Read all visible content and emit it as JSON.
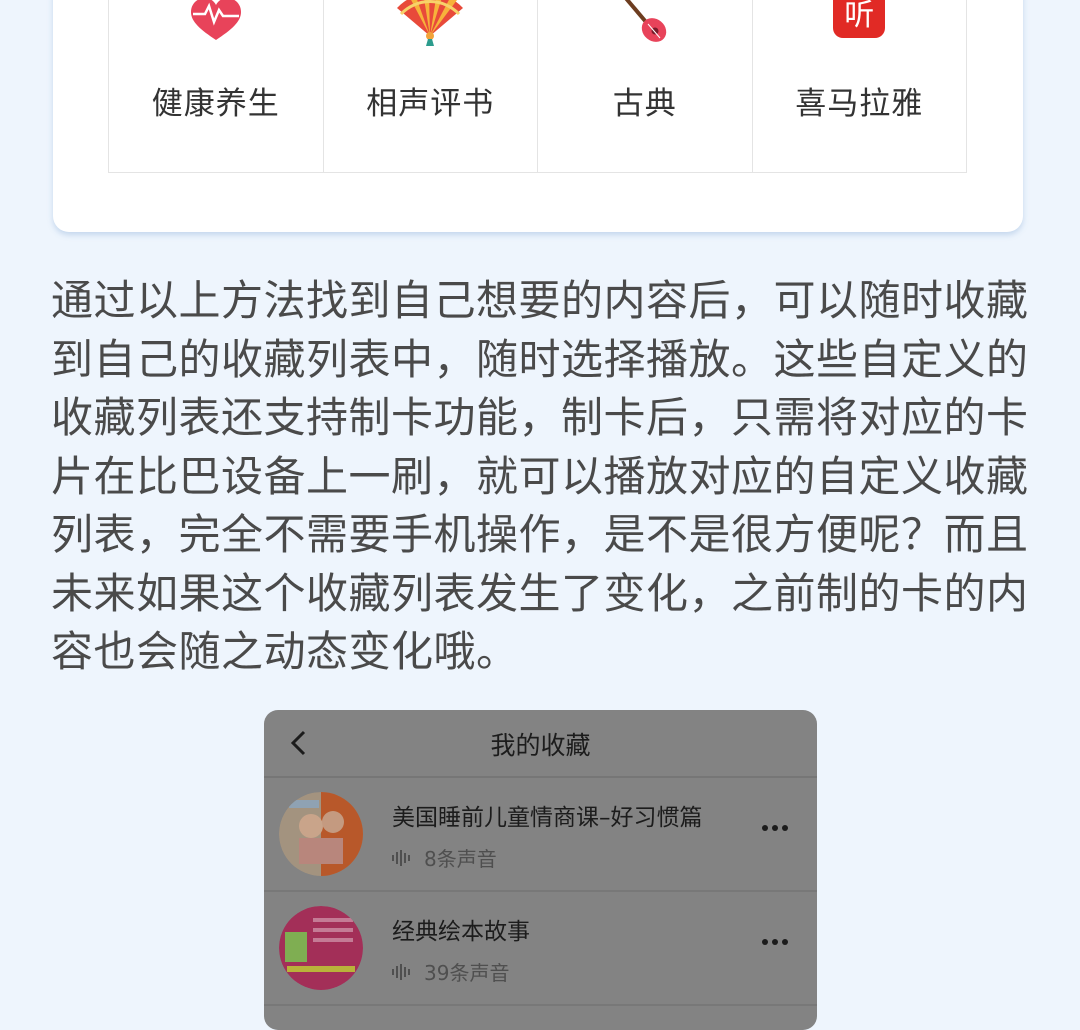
{
  "categories": [
    {
      "label": "健康养生",
      "icon": "heart-pulse-icon"
    },
    {
      "label": "相声评书",
      "icon": "folding-fan-icon"
    },
    {
      "label": "古典",
      "icon": "guitar-icon"
    },
    {
      "label": "喜马拉雅",
      "icon": "ximalaya-ting-icon"
    }
  ],
  "logo_text": "听",
  "paragraph": "通过以上方法找到自己想要的内容后，可以随时收藏到自己的收藏列表中，随时选择播放。这些自定义的收藏列表还支持制卡功能，制卡后，只需将对应的卡片在比巴设备上一刷，就可以播放对应的自定义收藏列表，完全不需要手机操作，是不是很方便呢？而且未来如果这个收藏列表发生了变化，之前制的卡的内容也会随之动态变化哦。",
  "favorites": {
    "title": "我的收藏",
    "items": [
      {
        "title": "美国睡前儿童情商课–好习惯篇",
        "count": "8条声音"
      },
      {
        "title": "经典绘本故事",
        "count": "39条声音"
      }
    ]
  },
  "colors": {
    "page_bg": "#eef5fd",
    "heart": "#e8435a",
    "logo_red": "#e12a25"
  }
}
